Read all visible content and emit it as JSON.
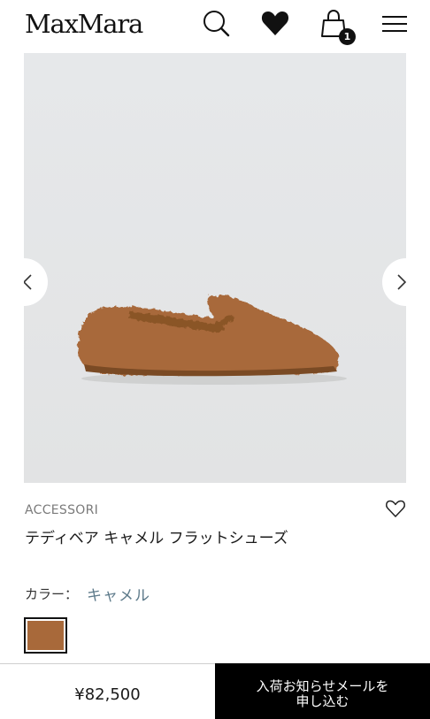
{
  "header": {
    "logo": "MaxMara",
    "bag_count": "1",
    "icons": [
      "search-icon",
      "heart-icon",
      "shopping-bag-icon",
      "menu-icon"
    ]
  },
  "product": {
    "category": "ACCESSORI",
    "name": "テディベア キャメル フラットシューズ",
    "color_label": "カラー：",
    "color_value": "キャメル",
    "swatch_color": "#a8693a",
    "price": "¥82,500"
  },
  "actions": {
    "notify_line1": "入荷お知らせメールを",
    "notify_line2": "申し込む"
  },
  "colors": {
    "background": "#ffffff",
    "image_background": "#e7e8e9",
    "accent_text": "#5d7a8a",
    "button_background": "#000000"
  }
}
